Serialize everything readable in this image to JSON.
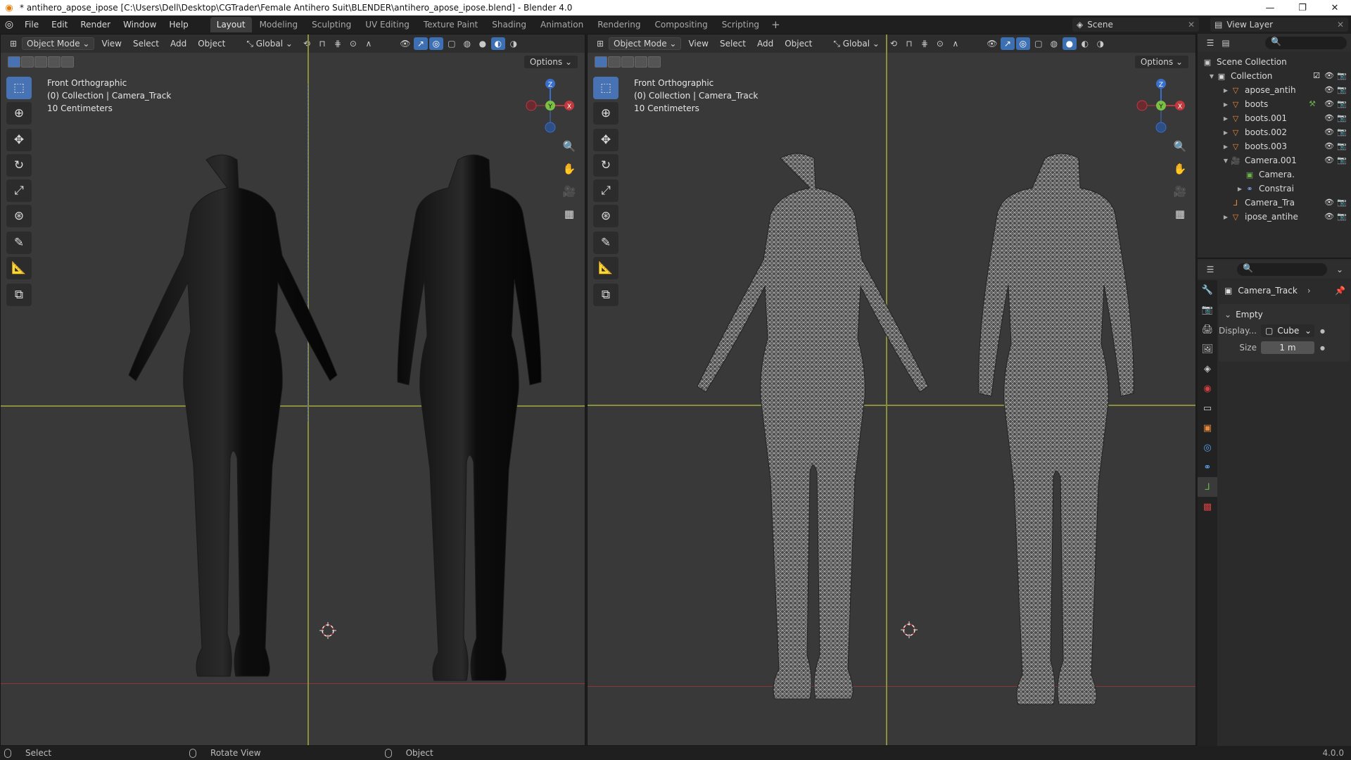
{
  "window": {
    "title": "* antihero_apose_ipose [C:\\Users\\Dell\\Desktop\\CGTrader\\Female Antihero Suit\\BLENDER\\antihero_apose_ipose.blend] - Blender 4.0",
    "controls": [
      "—",
      "❐",
      "✕"
    ]
  },
  "menu": [
    "File",
    "Edit",
    "Render",
    "Window",
    "Help"
  ],
  "workspaces": [
    "Layout",
    "Modeling",
    "Sculpting",
    "UV Editing",
    "Texture Paint",
    "Shading",
    "Animation",
    "Rendering",
    "Compositing",
    "Scripting"
  ],
  "active_workspace": "Layout",
  "add_workspace": "+",
  "scene": {
    "label": "Scene"
  },
  "view_layer": {
    "label": "View Layer"
  },
  "viewport_left": {
    "mode": "Object Mode",
    "menus": [
      "View",
      "Select",
      "Add",
      "Object"
    ],
    "transform": "Global",
    "options": "Options",
    "overlay": [
      "Front Orthographic",
      "(0) Collection | Camera_Track",
      "10 Centimeters"
    ],
    "shading": "solid-material"
  },
  "viewport_right": {
    "mode": "Object Mode",
    "menus": [
      "View",
      "Select",
      "Add",
      "Object"
    ],
    "transform": "Global",
    "options": "Options",
    "overlay": [
      "Front Orthographic",
      "(0) Collection | Camera_Track",
      "10 Centimeters"
    ],
    "shading": "wireframe"
  },
  "gizmo": {
    "z": "Z",
    "y": "Y",
    "x": "X"
  },
  "tools": [
    "select-box",
    "cursor",
    "move",
    "rotate",
    "scale",
    "transform",
    "annotate",
    "measure",
    "add-cube"
  ],
  "outliner": {
    "root": "Scene Collection",
    "collection": "Collection",
    "items": [
      {
        "name": "apose_antih",
        "type": "mesh"
      },
      {
        "name": "boots",
        "type": "mesh"
      },
      {
        "name": "boots.001",
        "type": "mesh"
      },
      {
        "name": "boots.002",
        "type": "mesh"
      },
      {
        "name": "boots.003",
        "type": "mesh"
      },
      {
        "name": "Camera.001",
        "type": "camera"
      },
      {
        "name": "Camera.",
        "type": "camera-data"
      },
      {
        "name": "Constrai",
        "type": "constraint"
      },
      {
        "name": "Camera_Tra",
        "type": "empty"
      },
      {
        "name": "ipose_antihe",
        "type": "mesh"
      }
    ]
  },
  "properties": {
    "object_name": "Camera_Track",
    "panel_title": "Empty",
    "display_label": "Display...",
    "display_value": "Cube",
    "size_label": "Size",
    "size_value": "1 m"
  },
  "status": {
    "items": [
      "Select",
      "Rotate View",
      "Object"
    ],
    "version": "4.0.0"
  }
}
